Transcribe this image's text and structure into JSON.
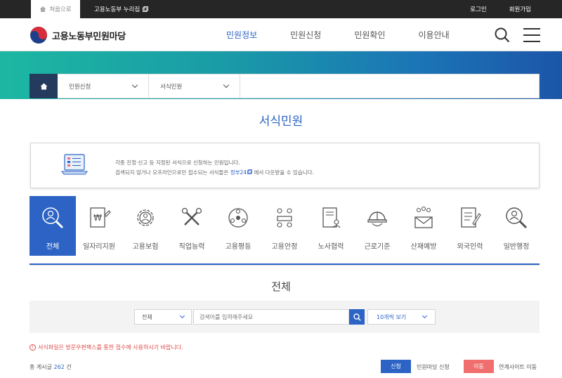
{
  "topbar": {
    "home_label": "처음으로",
    "portal_label": "고용노동부 누리집",
    "login": "로그인",
    "signup": "회원가입"
  },
  "header": {
    "site_name": "고용노동부민원마당",
    "nav": [
      {
        "label": "민원정보",
        "active": true
      },
      {
        "label": "민원신청",
        "active": false
      },
      {
        "label": "민원확인",
        "active": false
      },
      {
        "label": "이용안내",
        "active": false
      }
    ]
  },
  "breadcrumb": {
    "level1": "민원신청",
    "level2": "서식민원"
  },
  "page_title": "서식민원",
  "info": {
    "line1": "각종 진정·신고 등 지정된 서식으로 신청하는 민원입니다.",
    "line2_before": "검색되지 않거나 오프라인으로만 접수되는 서식들은",
    "line2_link": "정부24",
    "line2_after": "에서 다운받을 수 있습니다."
  },
  "categories": [
    {
      "label": "전체",
      "icon": "search-person-icon",
      "active": true
    },
    {
      "label": "일자리지원",
      "icon": "document-won-icon",
      "active": false
    },
    {
      "label": "고용보험",
      "icon": "gear-person-icon",
      "active": false
    },
    {
      "label": "직업능력",
      "icon": "tools-icon",
      "active": false
    },
    {
      "label": "고용평등",
      "icon": "circle-people-icon",
      "active": false
    },
    {
      "label": "고용안정",
      "icon": "group-meeting-icon",
      "active": false
    },
    {
      "label": "노사협력",
      "icon": "document-person-icon",
      "active": false
    },
    {
      "label": "근로기준",
      "icon": "hardhat-icon",
      "active": false
    },
    {
      "label": "산재예방",
      "icon": "mail-people-icon",
      "active": false
    },
    {
      "label": "외국인력",
      "icon": "document-pen-icon",
      "active": false
    },
    {
      "label": "일반행정",
      "icon": "search-person-icon",
      "active": false
    }
  ],
  "section_title": "전체",
  "search": {
    "category_value": "전체",
    "placeholder": "검색어를 입력해주세요",
    "page_size_value": "10개씩 보기"
  },
  "notice": "서식파일은 방문우편팩스를 통한 접수에 사용하시기 바랍니다.",
  "total": {
    "prefix": "총 게시글",
    "count": "262",
    "suffix": "건"
  },
  "legend": {
    "apply_button": "신청",
    "apply_label": "민원마당 신청",
    "move_button": "이동",
    "move_label": "연계사이트 이동"
  },
  "colors": {
    "accent": "#2c63c4",
    "band_start": "#1cb7a2",
    "band_end": "#1c55a8",
    "danger": "#e04848",
    "move_button": "#f06e6e"
  }
}
